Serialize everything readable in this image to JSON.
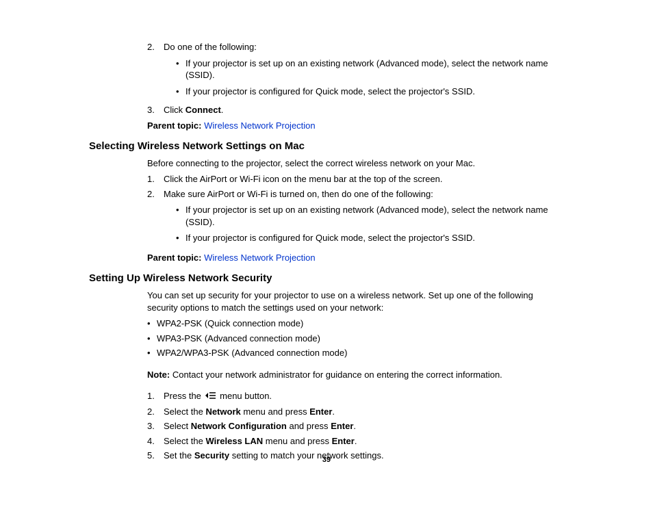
{
  "top": {
    "item2": {
      "num": "2.",
      "lead": "Do one of the following:",
      "b1": "If your projector is set up on an existing network (Advanced mode), select the network name (SSID).",
      "b2": "If your projector is configured for Quick mode, select the projector's SSID."
    },
    "item3": {
      "num": "3.",
      "pre": "Click ",
      "bold": "Connect",
      "post": "."
    },
    "parent": {
      "lbl": "Parent topic:",
      "link": "Wireless Network Projection"
    }
  },
  "mac": {
    "heading": "Selecting Wireless Network Settings on Mac",
    "intro": "Before connecting to the projector, select the correct wireless network on your Mac.",
    "s1": {
      "num": "1.",
      "text": "Click the AirPort or Wi-Fi icon on the menu bar at the top of the screen."
    },
    "s2": {
      "num": "2.",
      "lead": "Make sure AirPort or Wi-Fi is turned on, then do one of the following:",
      "b1": "If your projector is set up on an existing network (Advanced mode), select the network name (SSID).",
      "b2": "If your projector is configured for Quick mode, select the projector's SSID."
    },
    "parent": {
      "lbl": "Parent topic:",
      "link": "Wireless Network Projection"
    }
  },
  "sec": {
    "heading": "Setting Up Wireless Network Security",
    "intro": "You can set up security for your projector to use on a wireless network. Set up one of the following security options to match the settings used on your network:",
    "opt1": "WPA2-PSK (Quick connection mode)",
    "opt2": "WPA3-PSK (Advanced connection mode)",
    "opt3": "WPA2/WPA3-PSK (Advanced connection mode)",
    "note": {
      "lbl": "Note:",
      "text": " Contact your network administrator for guidance on entering the correct information."
    },
    "s1": {
      "num": "1.",
      "pre": "Press the ",
      "post": " menu button."
    },
    "s2": {
      "num": "2.",
      "pre": "Select the ",
      "b1": "Network",
      "mid": " menu and press ",
      "b2": "Enter",
      "post": "."
    },
    "s3": {
      "num": "3.",
      "pre": "Select ",
      "b1": "Network Configuration",
      "mid": " and press ",
      "b2": "Enter",
      "post": "."
    },
    "s4": {
      "num": "4.",
      "pre": "Select the ",
      "b1": "Wireless LAN",
      "mid": " menu and press ",
      "b2": "Enter",
      "post": "."
    },
    "s5": {
      "num": "5.",
      "pre": "Set the ",
      "b1": "Security",
      "post": " setting to match your network settings."
    }
  },
  "page_num": "39"
}
